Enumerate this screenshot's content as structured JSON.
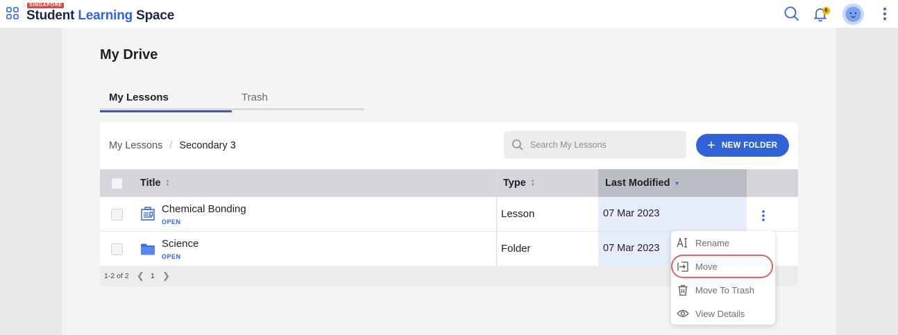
{
  "header": {
    "logo_tag": "SINGAPORE",
    "logo_part1": "Student",
    "logo_part2": "Learning",
    "logo_part3": "Space",
    "notification_count": "6"
  },
  "page": {
    "title": "My Drive",
    "tabs": [
      {
        "label": "My Lessons",
        "active": true
      },
      {
        "label": "Trash",
        "active": false
      }
    ]
  },
  "breadcrumb": {
    "root": "My Lessons",
    "separator": "/",
    "current": "Secondary 3"
  },
  "search": {
    "placeholder": "Search My Lessons",
    "value": ""
  },
  "new_folder_label": "NEW FOLDER",
  "table": {
    "columns": {
      "title": "Title",
      "type": "Type",
      "last_modified": "Last Modified"
    },
    "rows": [
      {
        "title": "Chemical Bonding",
        "status": "OPEN",
        "type": "Lesson",
        "last_modified": "07 Mar 2023",
        "icon": "lesson-icon"
      },
      {
        "title": "Science",
        "status": "OPEN",
        "type": "Folder",
        "last_modified": "07 Mar 2023",
        "icon": "folder-icon"
      }
    ],
    "pagination": {
      "range": "1-2 of 2",
      "page": "1"
    }
  },
  "context_menu": {
    "items": [
      {
        "label": "Rename",
        "icon": "rename-icon"
      },
      {
        "label": "Move",
        "icon": "move-icon"
      },
      {
        "label": "Move To Trash",
        "icon": "trash-icon"
      },
      {
        "label": "View Details",
        "icon": "eye-icon"
      }
    ]
  },
  "colors": {
    "brand_blue": "#2f63d6",
    "logo_dark": "#1a2540",
    "highlight_ring": "#d9625e",
    "badge": "#f0b400"
  }
}
